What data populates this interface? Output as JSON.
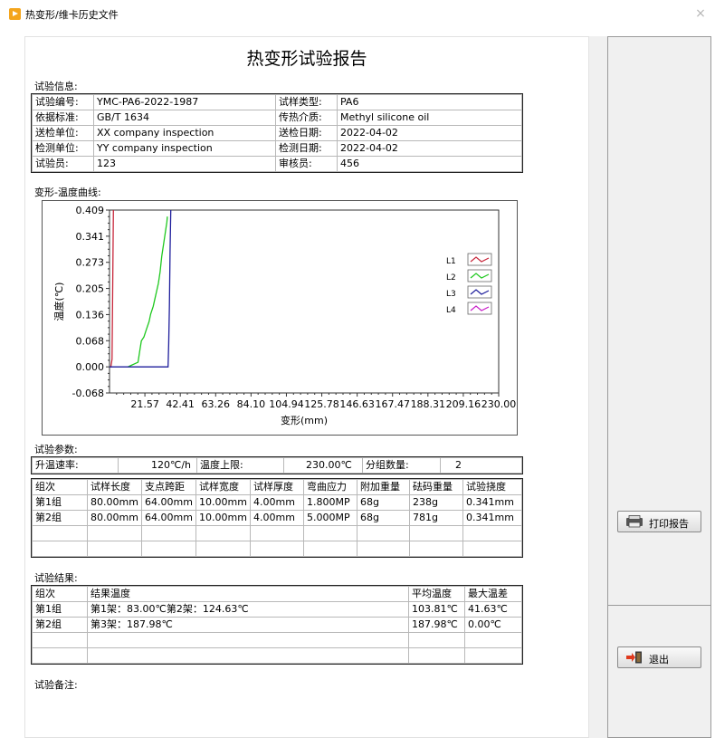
{
  "window": {
    "title": "热变形/维卡历史文件",
    "close": "×"
  },
  "report": {
    "title": "热变形试验报告",
    "info_label": "试验信息:",
    "info_rows": [
      [
        "试验编号:",
        "YMC-PA6-2022-1987",
        "试样类型:",
        "PA6"
      ],
      [
        "依据标准:",
        "GB/T 1634",
        "传热介质:",
        "Methyl silicone oil"
      ],
      [
        "送检单位:",
        "XX company inspection",
        "送检日期:",
        "2022-04-02"
      ],
      [
        "检测单位:",
        "YY company inspection",
        "检测日期:",
        "2022-04-02"
      ],
      [
        "试验员:",
        "123",
        "审核员:",
        "456"
      ]
    ],
    "chart_label": "变形-温度曲线:",
    "params_label": "试验参数:",
    "params": [
      "升温速率:",
      "120℃/h",
      "温度上限:",
      "230.00℃",
      "分组数量:",
      "2"
    ],
    "params_header": [
      "组次",
      "试样长度",
      "支点跨距",
      "试样宽度",
      "试样厚度",
      "弯曲应力",
      "附加重量",
      "砝码重量",
      "试验挠度"
    ],
    "params_rows": [
      [
        "第1组",
        "80.00mm",
        "64.00mm",
        "10.00mm",
        "4.00mm",
        "1.800MP",
        "68g",
        "238g",
        "0.341mm"
      ],
      [
        "第2组",
        "80.00mm",
        "64.00mm",
        "10.00mm",
        "4.00mm",
        "5.000MP",
        "68g",
        "781g",
        "0.341mm"
      ],
      [
        "",
        "",
        "",
        "",
        "",
        "",
        "",
        "",
        ""
      ],
      [
        "",
        "",
        "",
        "",
        "",
        "",
        "",
        "",
        ""
      ]
    ],
    "results_label": "试验结果:",
    "results_header": [
      "组次",
      "结果温度",
      "平均温度",
      "最大温差"
    ],
    "results_rows": [
      [
        "第1组",
        "第1架：83.00℃第2架：124.63℃",
        "103.81℃",
        "41.63℃"
      ],
      [
        "第2组",
        "第3架：187.98℃",
        "187.98℃",
        "0.00℃"
      ],
      [
        "",
        "",
        "",
        ""
      ],
      [
        "",
        "",
        "",
        ""
      ]
    ],
    "remarks_label": "试验备注:"
  },
  "buttons": {
    "print": "打印报告",
    "exit": "退出"
  },
  "chart_data": {
    "type": "line",
    "xlabel": "变形(mm)",
    "ylabel": "温度(℃)",
    "xlim": [
      0.72,
      230.0
    ],
    "ylim": [
      -0.068,
      0.409
    ],
    "x_ticks": [
      "21.57",
      "42.41",
      "63.26",
      "84.10",
      "104.94",
      "125.78",
      "146.63",
      "167.47",
      "188.31",
      "209.16",
      "230.00"
    ],
    "y_ticks": [
      "0.409",
      "0.341",
      "0.273",
      "0.205",
      "0.136",
      "0.068",
      "0.000",
      "-0.068"
    ],
    "grid": true,
    "legend_position": "right",
    "series": [
      {
        "name": "L1",
        "color": "#c8283c",
        "points": [
          [
            0.72,
            0.0
          ],
          [
            1.5,
            0.0
          ],
          [
            2.2,
            0.02
          ],
          [
            3.0,
            0.409
          ]
        ]
      },
      {
        "name": "L2",
        "color": "#1ec81e",
        "points": [
          [
            11.5,
            0.0
          ],
          [
            13.5,
            0.004
          ],
          [
            15.5,
            0.008
          ],
          [
            17.5,
            0.012
          ],
          [
            18.5,
            0.04
          ],
          [
            19.5,
            0.068
          ],
          [
            21.0,
            0.078
          ],
          [
            22.5,
            0.098
          ],
          [
            24.0,
            0.118
          ],
          [
            25.0,
            0.138
          ],
          [
            26.5,
            0.158
          ],
          [
            27.5,
            0.178
          ],
          [
            28.5,
            0.198
          ],
          [
            29.5,
            0.218
          ],
          [
            30.5,
            0.248
          ],
          [
            31.5,
            0.288
          ],
          [
            32.5,
            0.318
          ],
          [
            33.5,
            0.348
          ],
          [
            34.5,
            0.378
          ],
          [
            34.8,
            0.392
          ]
        ]
      },
      {
        "name": "L3",
        "color": "#1e1e9c",
        "points": [
          [
            0.72,
            0.0
          ],
          [
            35.2,
            0.0
          ],
          [
            35.6,
            0.06
          ],
          [
            36.0,
            0.16
          ],
          [
            36.4,
            0.3
          ],
          [
            36.8,
            0.409
          ]
        ]
      },
      {
        "name": "L4",
        "color": "#c81ec8",
        "points": []
      }
    ]
  }
}
